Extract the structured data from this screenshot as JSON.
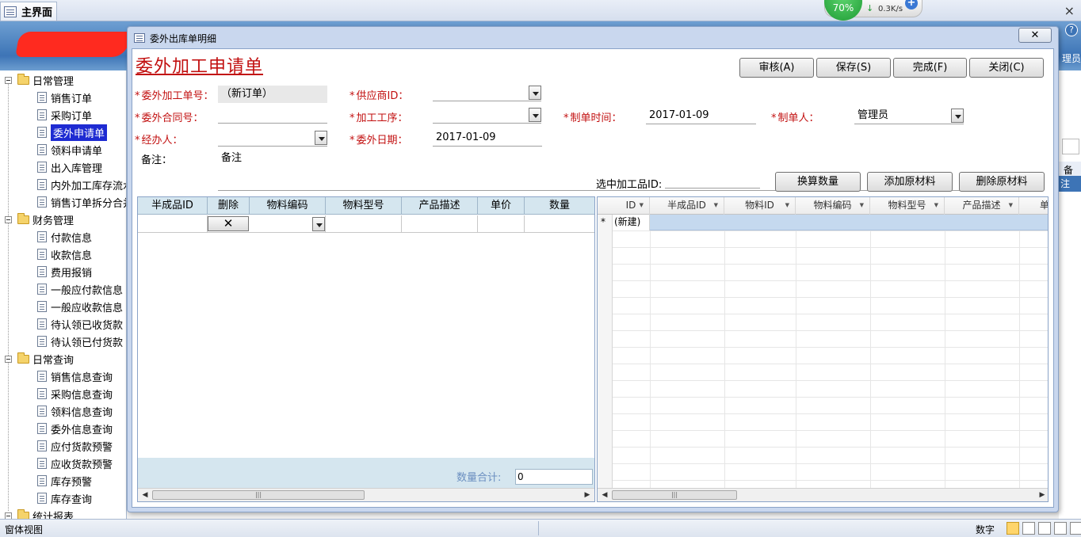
{
  "main_window": {
    "tab_label": "主界面",
    "close_symbol": "×",
    "help_symbol": "?",
    "user_partial": "理员"
  },
  "speed_widget": {
    "percent": "70%",
    "download_arrow": "↓",
    "speed": "0.3K/s",
    "plus": "+"
  },
  "nav": {
    "groups": [
      {
        "label": "日常管理",
        "items": [
          "销售订单",
          "采购订单",
          "委外申请单",
          "领料申请单",
          "出入库管理",
          "内外加工库存流水",
          "销售订单拆分合并"
        ]
      },
      {
        "label": "财务管理",
        "items": [
          "付款信息",
          "收款信息",
          "费用报销",
          "一般应付款信息",
          "一般应收款信息",
          "待认领已收货款",
          "待认领已付货款"
        ]
      },
      {
        "label": "日常查询",
        "items": [
          "销售信息查询",
          "采购信息查询",
          "领料信息查询",
          "委外信息查询",
          "应付货款预警",
          "应收货款预警",
          "库存预警",
          "库存查询"
        ]
      },
      {
        "label": "统计报表",
        "items": []
      }
    ],
    "selected": "委外申请单"
  },
  "dialog": {
    "title": "委外出库单明细",
    "close_symbol": "✕",
    "form_title": "委外加工申请单",
    "buttons": {
      "approve": "审核(A)",
      "save": "保存(S)",
      "complete": "完成(F)",
      "close": "关闭(C)",
      "convert_qty": "换算数量",
      "add_material": "添加原材料",
      "delete_material": "删除原材料"
    },
    "fields": {
      "order_no_label": "委外加工单号：",
      "order_no_value": "（新订单）",
      "supplier_label": "供应商ID：",
      "supplier_value": "",
      "contract_label": "委外合同号：",
      "contract_value": "",
      "process_label": "加工工序：",
      "process_value": "",
      "created_time_label": "制单时间：",
      "created_time_value": "2017-01-09",
      "creator_label": "制单人：",
      "creator_value": "管理员",
      "handler_label": "经办人：",
      "handler_value": "",
      "outsource_date_label": "委外日期：",
      "outsource_date_value": "2017-01-09",
      "remark_label": "备注：",
      "remark_value": "备注",
      "selected_id_label": "选中加工品ID:",
      "selected_id_value": ""
    },
    "required_mark": "*",
    "left_table": {
      "columns": [
        "半成品ID",
        "删除",
        "物料编码",
        "物料型号",
        "产品描述",
        "单价",
        "数量"
      ],
      "delete_symbol": "✕",
      "total_label": "数量合计:",
      "total_value": "0"
    },
    "right_table": {
      "columns": [
        "ID",
        "半成品ID",
        "物料ID",
        "物料编码",
        "物料型号",
        "产品描述",
        "单"
      ],
      "new_row_marker": "*",
      "new_row_label": "(新建)"
    }
  },
  "background_strip": {
    "header_partial": "备注",
    "row_partial": "注"
  },
  "status_bar": {
    "left": "窗体视图",
    "right": "数字"
  }
}
